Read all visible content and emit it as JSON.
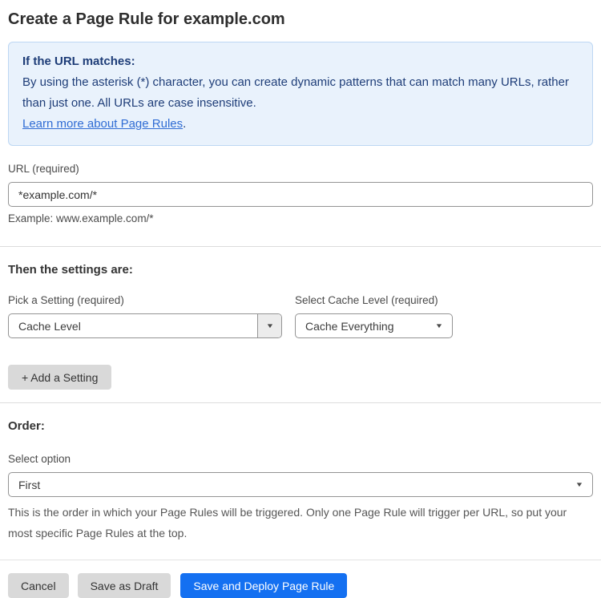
{
  "page": {
    "title": "Create a Page Rule for example.com"
  },
  "info_box": {
    "heading": "If the URL matches:",
    "body": "By using the asterisk (*) character, you can create dynamic patterns that can match many URLs, rather than just one. All URLs are case insensitive.",
    "link_label": "Learn more about Page Rules",
    "link_suffix": "."
  },
  "url_field": {
    "label": "URL (required)",
    "value": "*example.com/*",
    "helper": "Example: www.example.com/*"
  },
  "settings_section": {
    "heading": "Then the settings are:",
    "setting_picker": {
      "label": "Pick a Setting (required)",
      "value": "Cache Level"
    },
    "cache_level_picker": {
      "label": "Select Cache Level (required)",
      "value": "Cache Everything"
    },
    "add_setting_label": "+ Add a Setting"
  },
  "order_section": {
    "heading": "Order:",
    "label": "Select option",
    "value": "First",
    "helper": "This is the order in which your Page Rules will be triggered. Only one Page Rule will trigger per URL, so put your most specific Page Rules at the top."
  },
  "actions": {
    "cancel": "Cancel",
    "save_draft": "Save as Draft",
    "save_deploy": "Save and Deploy Page Rule"
  },
  "icons": {
    "dropdown_arrow": "▼"
  },
  "colors": {
    "accent_blue": "#1470f1",
    "info_background": "#e9f2fc",
    "info_border": "#bdd7f3",
    "info_text": "#1e3d78",
    "link_blue": "#2f6cd4",
    "button_gray": "#d9d9d9"
  }
}
